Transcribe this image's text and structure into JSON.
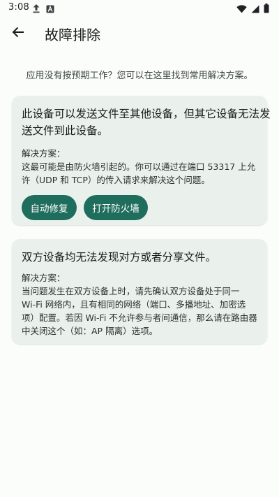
{
  "status_bar": {
    "time": "3:08",
    "icons": [
      "upload-icon",
      "notification-a-icon",
      "wifi-icon",
      "cellular-icon",
      "battery-icon"
    ]
  },
  "header": {
    "title": "故障排除",
    "back_icon": "arrow-back-icon"
  },
  "intro": "应用没有按预期工作？您可以在这里找到常用解决方案。",
  "cards": [
    {
      "title_lines": [
        "此设备可以发送文件至其他设备，但其它设备无法发",
        "送文件到此设备。"
      ],
      "body_lines": [
        "解决方案：",
        "这最可能是由防火墙引起的。你可以通过在端口 53317 上允",
        "许（UDP 和 TCP）的传入请求来解决这个问题。"
      ],
      "buttons": [
        "自动修复",
        "打开防火墙"
      ]
    },
    {
      "title_lines": [
        "双方设备均无法发现对方或者分享文件。"
      ],
      "body_lines": [
        "解决方案：",
        "当问题发生在双方设备上时，请先确认双方设备处于同一",
        "Wi-Fi 网络内，且有相同的网络（端口、多播地址、加密选",
        "项）配置。若因 Wi-Fi 不允许参与者间通信，那么请在路由器",
        "中关闭这个（如：AP 隔离）选项。"
      ]
    }
  ],
  "colors": {
    "background": "#fbfdfb",
    "card": "#eaf1ed",
    "button": "#1f6d5d",
    "button_text": "#ffffff"
  }
}
